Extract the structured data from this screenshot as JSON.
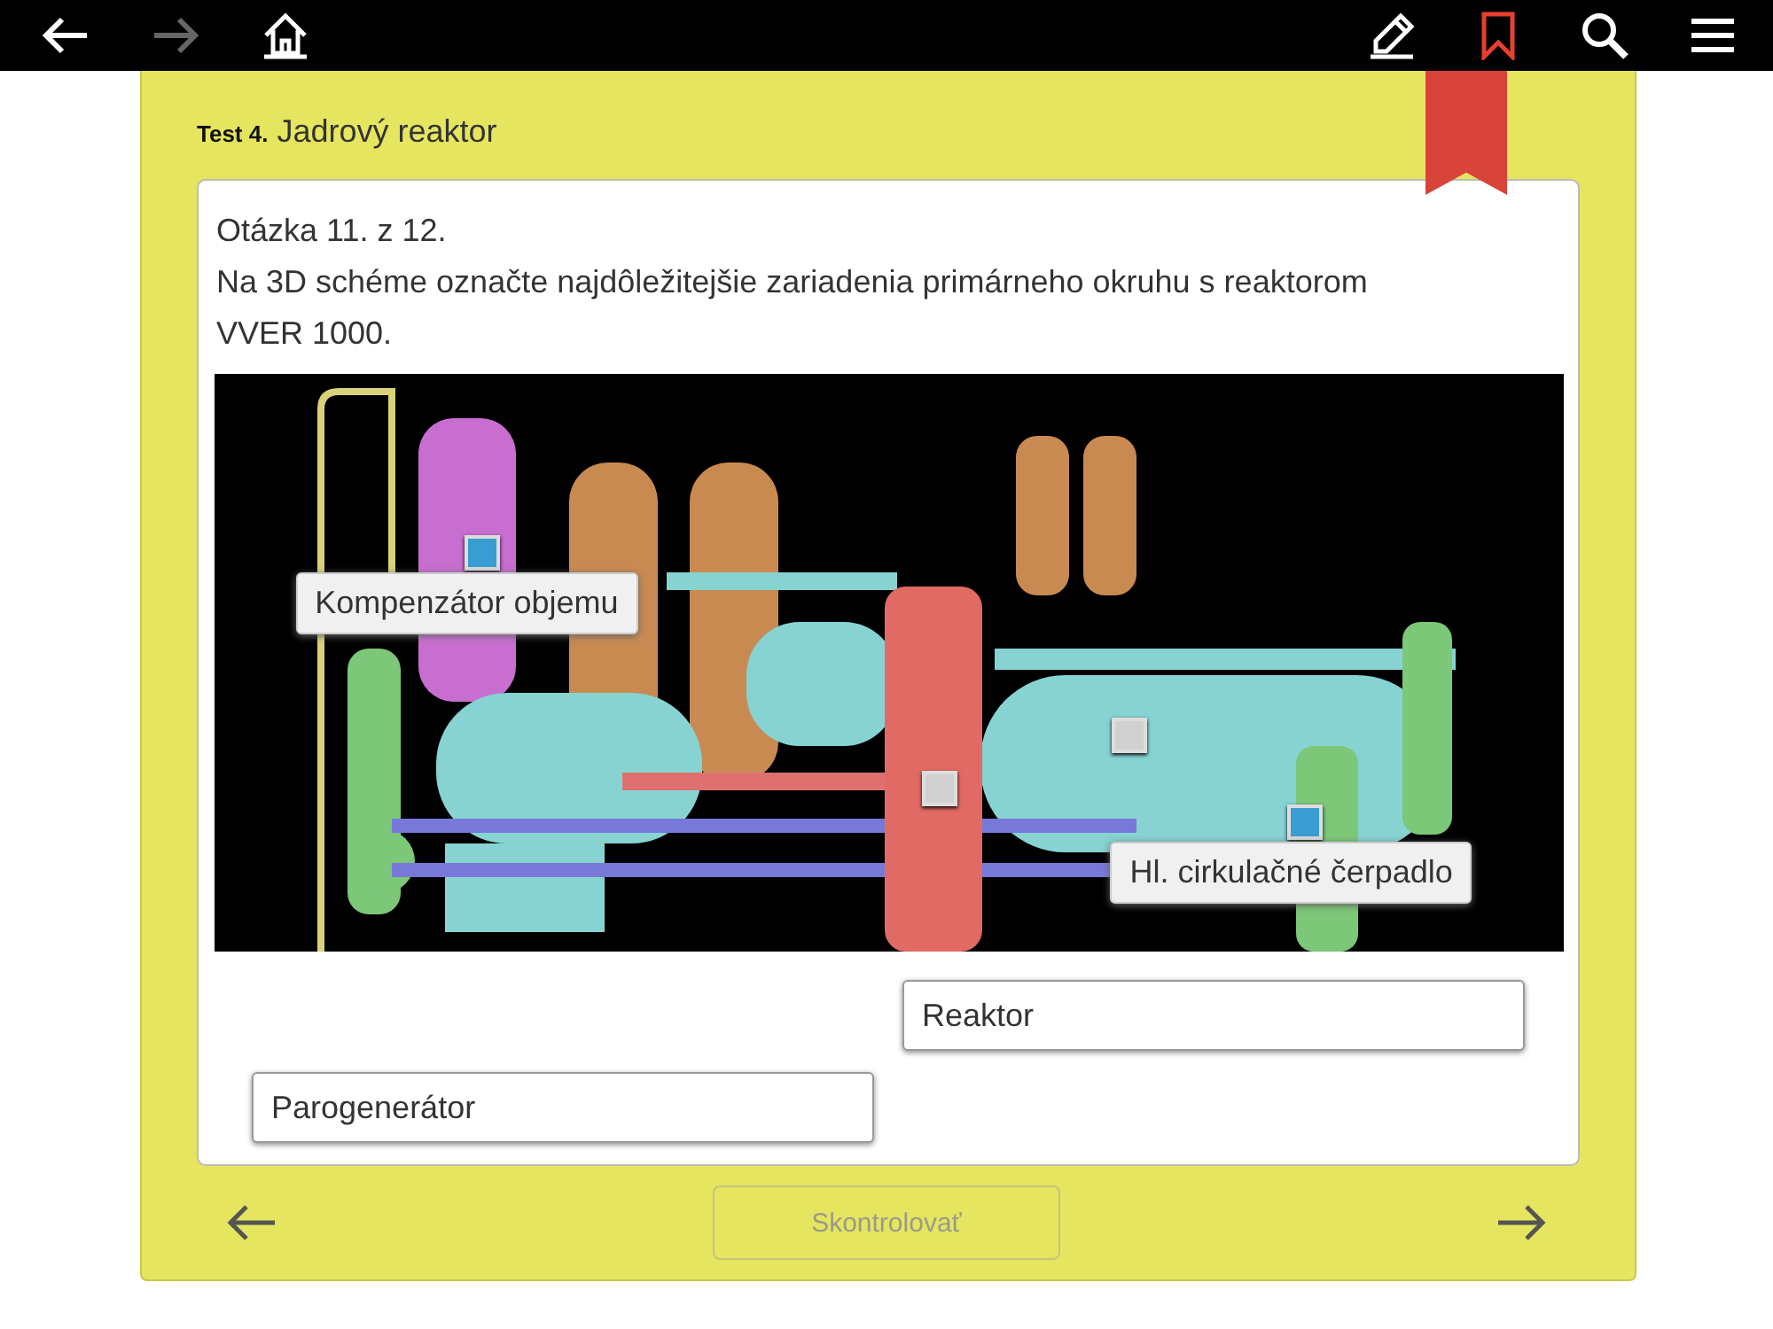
{
  "toolbar": [
    {
      "kind": "back",
      "disabled": false,
      "selected": false
    },
    {
      "kind": "forward",
      "disabled": true,
      "selected": false
    },
    {
      "kind": "home",
      "disabled": false,
      "selected": false
    },
    {
      "kind": "edit",
      "disabled": false,
      "selected": false
    },
    {
      "kind": "bookmark",
      "disabled": false,
      "selected": true
    },
    {
      "kind": "search",
      "disabled": false,
      "selected": false
    },
    {
      "kind": "menu",
      "disabled": false,
      "selected": false
    }
  ],
  "test": {
    "number": "Test 4.",
    "title": "Jadrový reaktor"
  },
  "question": {
    "counter": "Otázka 11. z 12.",
    "text": "Na 3D schéme označte najdôležitejšie zariadenia primárneho okruhu s reaktorom VVER 1000."
  },
  "scene": {
    "markers": [
      {
        "selected": true
      },
      {
        "selected": false
      },
      {
        "selected": false
      },
      {
        "selected": true
      }
    ],
    "placed_labels": [
      "Kompenzátor objemu",
      "Hl. cirkulačné čerpadlo"
    ]
  },
  "answers": [
    "Reaktor",
    "Parogenerátor"
  ],
  "check_button": {
    "label": "Skontrolovať",
    "disabled": true
  }
}
